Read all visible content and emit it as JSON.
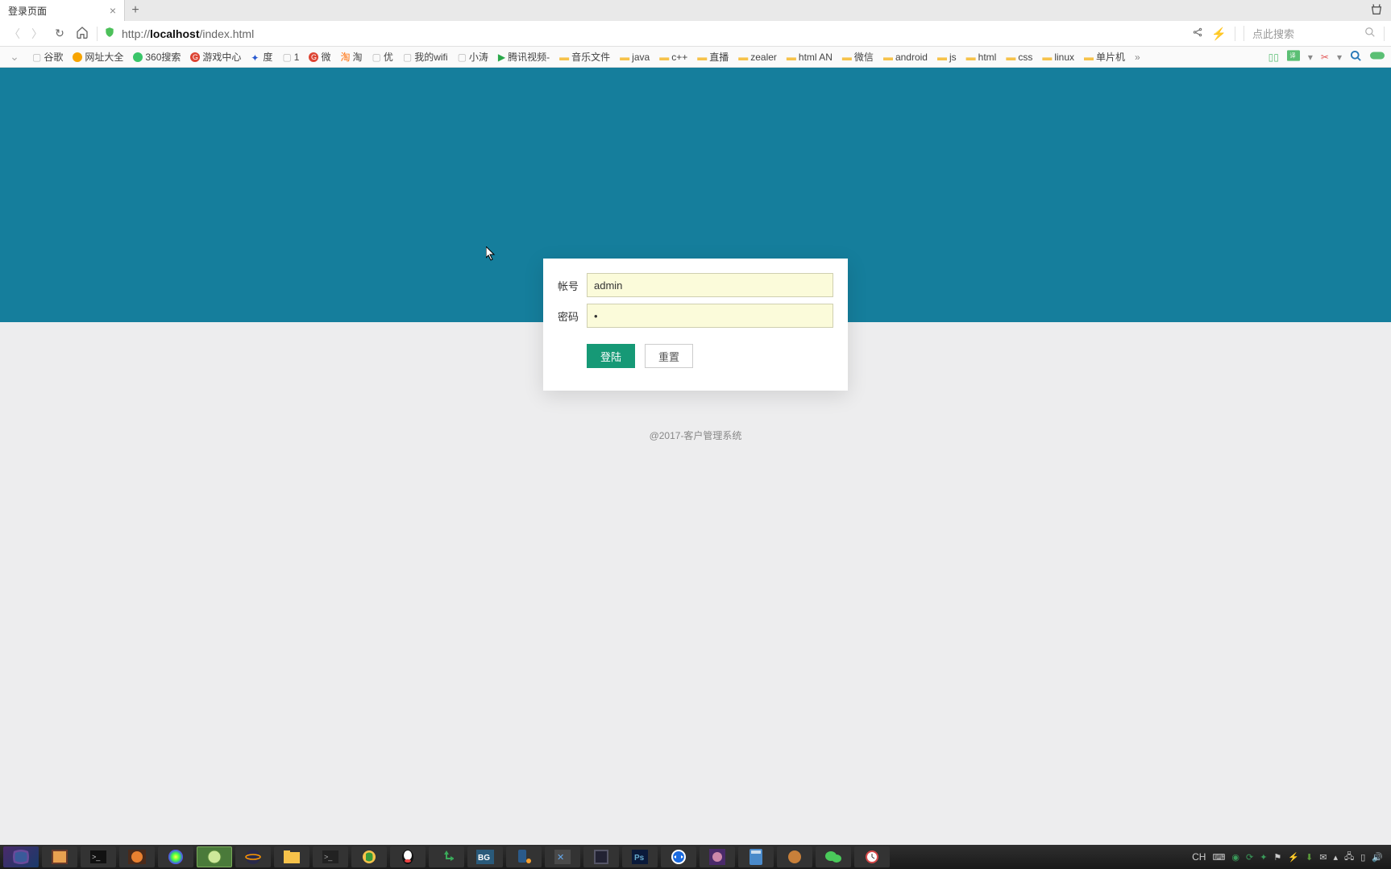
{
  "browser": {
    "tab_title": "登录页面",
    "url_prefix": "http://",
    "url_host": "localhost",
    "url_path": "/index.html",
    "search_placeholder": "点此搜索",
    "bookmarks": [
      {
        "label": "谷歌",
        "icon": "page"
      },
      {
        "label": "网址大全",
        "icon": "yellow"
      },
      {
        "label": "360搜索",
        "icon": "360"
      },
      {
        "label": "游戏中心",
        "icon": "red"
      },
      {
        "label": "度",
        "icon": "baidu"
      },
      {
        "label": "1",
        "icon": "page"
      },
      {
        "label": "微",
        "icon": "red"
      },
      {
        "label": "淘",
        "icon": "orange"
      },
      {
        "label": "优",
        "icon": "page"
      },
      {
        "label": "我的wifi",
        "icon": "page"
      },
      {
        "label": "小涛",
        "icon": "page"
      },
      {
        "label": "腾讯视频-",
        "icon": "tencent"
      },
      {
        "label": "音乐文件",
        "icon": "folder"
      },
      {
        "label": "java",
        "icon": "folder"
      },
      {
        "label": "c++",
        "icon": "folder"
      },
      {
        "label": "直播",
        "icon": "folder"
      },
      {
        "label": "zealer",
        "icon": "folder"
      },
      {
        "label": "html AN",
        "icon": "folder"
      },
      {
        "label": "微信",
        "icon": "folder"
      },
      {
        "label": "android",
        "icon": "folder"
      },
      {
        "label": "js",
        "icon": "folder"
      },
      {
        "label": "html",
        "icon": "folder"
      },
      {
        "label": "css",
        "icon": "folder"
      },
      {
        "label": "linux",
        "icon": "folder"
      },
      {
        "label": "单片机",
        "icon": "folder"
      }
    ]
  },
  "login": {
    "username_label": "帐号",
    "username_value": "admin",
    "password_label": "密码",
    "password_value": "•",
    "login_button": "登陆",
    "reset_button": "重置"
  },
  "footer": "@2017-客户管理系统",
  "tray": {
    "lang": "CH"
  }
}
